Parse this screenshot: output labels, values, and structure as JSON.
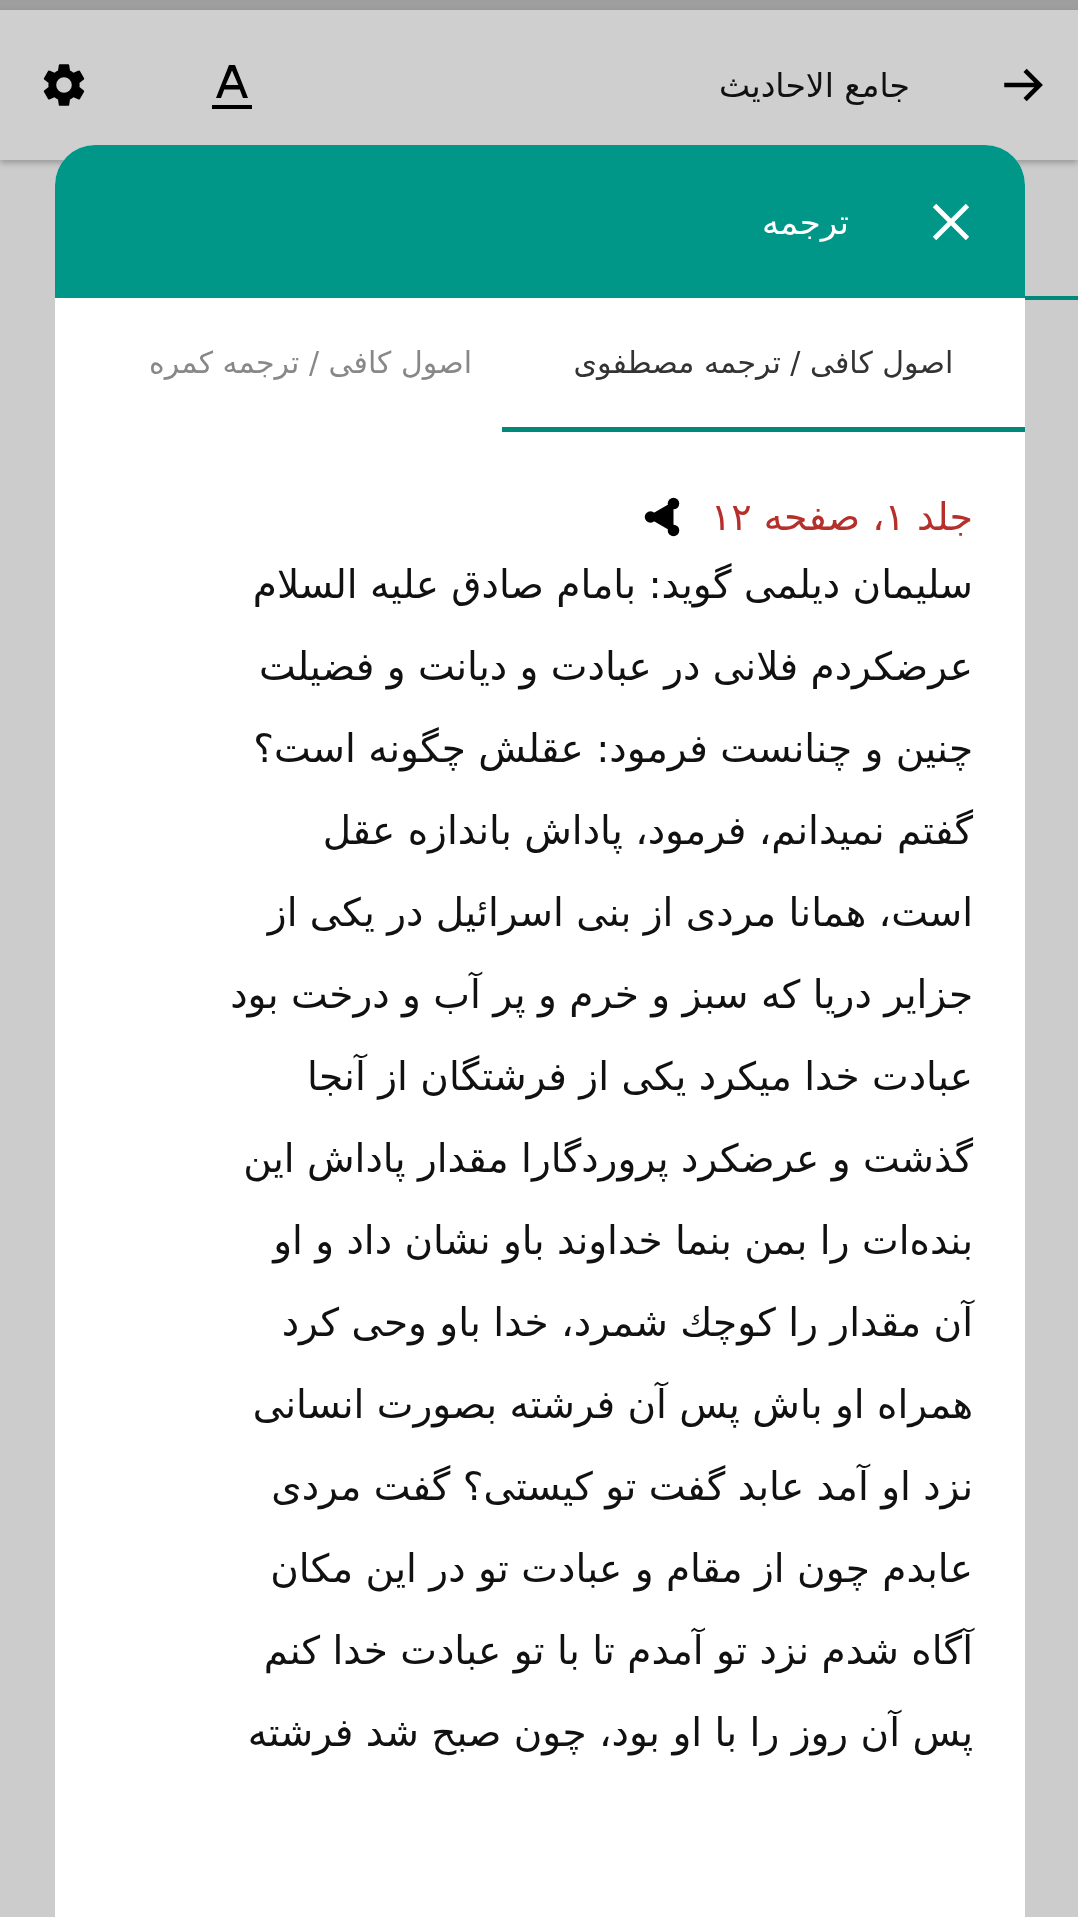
{
  "app_bar": {
    "title": "جامع الاحادیث"
  },
  "dialog": {
    "title": "ترجمه",
    "tabs": [
      {
        "label": "اصول کافی / ترجمه مصطفوی",
        "selected": true
      },
      {
        "label": "اصول کافی / ترجمه کمره",
        "selected": false
      }
    ],
    "reference": "جلد ۱، صفحه ۱۲",
    "lines": [
      "سلیمان دیلمی گوید: بامام صادق علیه السلام",
      "عرضکردم فلانی در عبادت و دیانت و فضیلت",
      "چنین و چنانست فرمود: عقلش چگونه است؟",
      "گفتم نمیدانم، فرمود، پاداش باندازه عقل",
      "است، همانا مردی از بنی اسرائیل در یکی از",
      "جزایر دریا که سبز و خرم و پر آب و درخت بود",
      "عبادت خدا میکرد یکی از فرشتگان از آنجا",
      "گذشت و عرضکرد پروردگارا مقدار پاداش این",
      "بنده‌ات را بمن بنما خداوند باو نشان داد و او",
      "آن مقدار را کوچك شمرد، خدا باو وحی کرد",
      "همراه او باش پس آن فرشته بصورت انسانی",
      "نزد او آمد عابد گفت تو کیستی؟ گفت مردی",
      "عابدم چون از مقام و عبادت تو در این مکان",
      "آگاه شدم نزد تو آمدم تا با تو عبادت خدا کنم",
      "پس آن روز را با او بود، چون صبح شد فرشته"
    ]
  }
}
